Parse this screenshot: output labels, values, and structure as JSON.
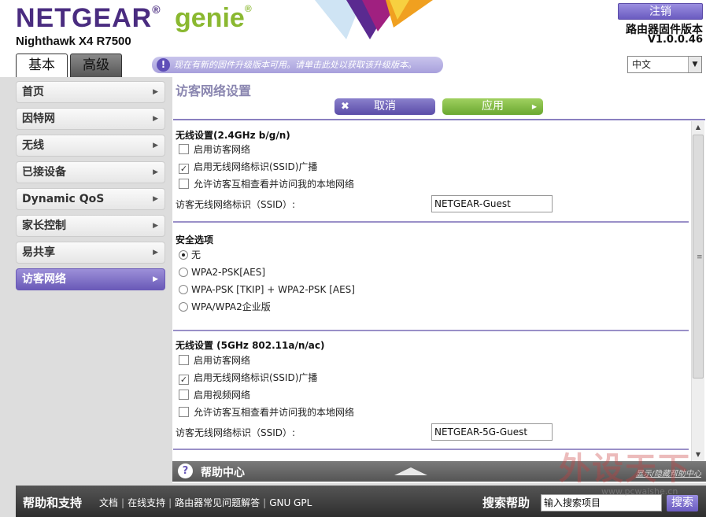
{
  "header": {
    "brand": "NETGEAR",
    "brand_sub": "genie",
    "reg_mark": "®",
    "model": "Nighthawk X4 R7500",
    "logout": "注销",
    "firmware_label": "路由器固件版本",
    "firmware_version": "V1.0.0.46",
    "tabs": [
      {
        "label": "基本",
        "active": true
      },
      {
        "label": "高级",
        "active": false
      }
    ],
    "notice": "现在有新的固件升级版本可用。请单击此处以获取该升级版本。",
    "notice_icon": "!",
    "language": "中文"
  },
  "sidebar": {
    "items": [
      {
        "label": "首页",
        "active": false
      },
      {
        "label": "因特网",
        "active": false
      },
      {
        "label": "无线",
        "active": false
      },
      {
        "label": "已接设备",
        "active": false
      },
      {
        "label": "Dynamic QoS",
        "active": false
      },
      {
        "label": "家长控制",
        "active": false
      },
      {
        "label": "易共享",
        "active": false
      },
      {
        "label": "访客网络",
        "active": true
      }
    ]
  },
  "main": {
    "title": "访客网络设置",
    "cancel_label": "取消",
    "apply_label": "应用",
    "wireless_24": {
      "title": "无线设置(2.4GHz b/g/n)",
      "options": [
        {
          "label": "启用访客网络",
          "checked": false
        },
        {
          "label": "启用无线网络标识(SSID)广播",
          "checked": true
        },
        {
          "label": "允许访客互相查看并访问我的本地网络",
          "checked": false
        }
      ],
      "ssid_label": "访客无线网络标识（SSID）:",
      "ssid_value": "NETGEAR-Guest"
    },
    "security": {
      "title": "安全选项",
      "options": [
        {
          "label": "无",
          "selected": true
        },
        {
          "label": "WPA2-PSK[AES]",
          "selected": false
        },
        {
          "label": "WPA-PSK [TKIP] + WPA2-PSK [AES]",
          "selected": false
        },
        {
          "label": "WPA/WPA2企业版",
          "selected": false
        }
      ]
    },
    "wireless_5": {
      "title": "无线设置 (5GHz 802.11a/n/ac)",
      "options": [
        {
          "label": "启用访客网络",
          "checked": false
        },
        {
          "label": "启用无线网络标识(SSID)广播",
          "checked": true
        },
        {
          "label": "启用视频网络",
          "checked": false
        },
        {
          "label": "允许访客互相查看并访问我的本地网络",
          "checked": false
        }
      ],
      "ssid_label": "访客无线网络标识（SSID）:",
      "ssid_value": "NETGEAR-5G-Guest"
    }
  },
  "help": {
    "title": "帮助中心",
    "show_label": "显示/隐藏帮助中心"
  },
  "footer": {
    "title": "帮助和支持",
    "links": [
      "文档",
      "在线支持",
      "路由器常见问题解答",
      "GNU GPL"
    ],
    "search_title": "搜索帮助",
    "search_value": "输入搜索项目",
    "search_button": "搜索"
  },
  "watermark": {
    "text": "外设天下",
    "url": "www.pcwaishe.cn"
  },
  "colors": {
    "accent": "#6a5ab8",
    "apply": "#7ab83a",
    "brand_purple": "#4a2c80",
    "brand_green": "#8ab830"
  },
  "icons": {
    "notice": "exclamation-circle-icon",
    "help": "question-circle-icon",
    "chevron": "chevron-right-icon",
    "cancel": "x-icon",
    "apply": "triangle-right-icon"
  }
}
